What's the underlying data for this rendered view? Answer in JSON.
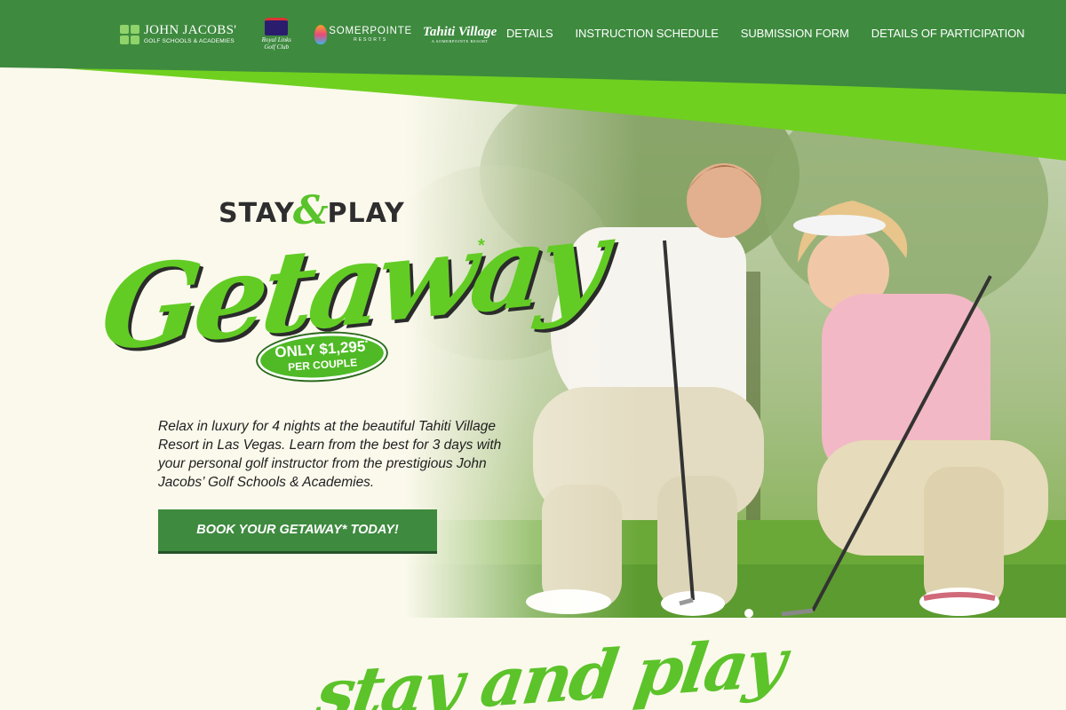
{
  "logos": {
    "jj_line1": "JOHN JACOBS'",
    "jj_line2": "GOLF SCHOOLS & ACADEMIES",
    "royal_links_line1": "Royal Links",
    "royal_links_line2": "Golf Club",
    "somerpointe_line1": "SOMERPOINTE",
    "somerpointe_line2": "RESORTS",
    "tahiti_line1": "Tahiti Village",
    "tahiti_line2": "A SOMERPOINTE RESORT"
  },
  "nav": {
    "items": [
      {
        "label": "DETAILS"
      },
      {
        "label": "INSTRUCTION SCHEDULE"
      },
      {
        "label": "SUBMISSION FORM"
      },
      {
        "label": "DETAILS OF PARTICIPATION"
      }
    ]
  },
  "hero": {
    "stay": "STAY",
    "amp": "&",
    "play": "PLAY",
    "getaway": "Getaway",
    "getaway_mark": "*",
    "price_prefix": "ONLY $1,295",
    "price_mark": "*",
    "price_suffix": "PER COUPLE",
    "description": "Relax in luxury for 4 nights at the beautiful Tahiti Village Resort in Las Vegas. Learn from the best for 3 days with your personal golf instructor from the prestigious John Jacobs’ Golf Schools & Academies.",
    "cta": "BOOK YOUR GETAWAY* TODAY!"
  },
  "section2": {
    "script_title": "stay and play"
  },
  "colors": {
    "header_green": "#3e8a3f",
    "accent_lime": "#6fd020",
    "cream": "#fbf9ec"
  },
  "icons": [
    "john-jacobs-logo-icon",
    "royal-links-crown-icon",
    "somerpointe-logo-icon"
  ]
}
